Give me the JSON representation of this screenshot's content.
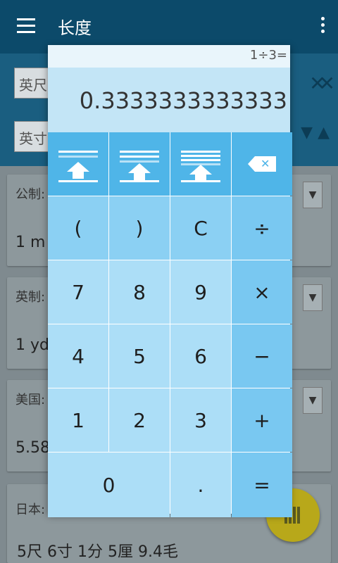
{
  "appbar": {
    "title": "长度"
  },
  "background": {
    "from_unit": "英尺",
    "to_unit": "英寸",
    "cards": [
      {
        "label": "公制:",
        "value": "1 m"
      },
      {
        "label": "英制:",
        "value": "1 yd"
      },
      {
        "label": "美国:",
        "value": "5.58"
      },
      {
        "label": "日本:",
        "value": "5尺 6寸 1分 5厘 9.4毛"
      }
    ]
  },
  "calculator": {
    "expression": "1÷3=",
    "result": "0.3333333333333",
    "keys": {
      "mem1": "memory-1",
      "mem2": "memory-2",
      "mem3": "memory-3",
      "backspace": "backspace",
      "open_paren": "(",
      "close_paren": ")",
      "clear": "C",
      "divide": "÷",
      "seven": "7",
      "eight": "8",
      "nine": "9",
      "multiply": "×",
      "four": "4",
      "five": "5",
      "six": "6",
      "minus": "−",
      "one": "1",
      "two": "2",
      "three": "3",
      "plus": "+",
      "zero": "0",
      "dot": ".",
      "equals": "="
    }
  }
}
